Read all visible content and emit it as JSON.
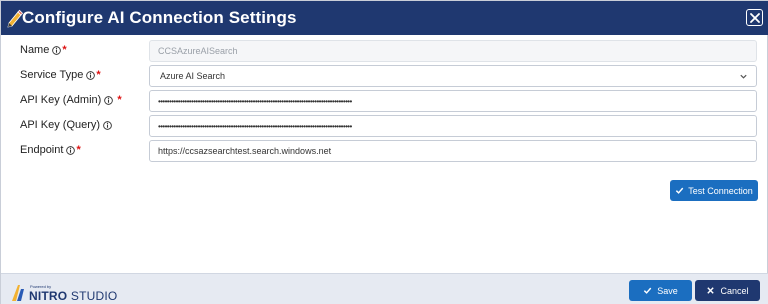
{
  "dialog": {
    "title": "Configure AI Connection Settings",
    "title_icon": "pencil-icon",
    "close_icon": "close-icon"
  },
  "form": {
    "name": {
      "label": "Name",
      "value": "CCSAzureAISearch",
      "required": true,
      "disabled": true
    },
    "service_type": {
      "label": "Service Type",
      "value": "Azure AI Search",
      "required": true
    },
    "api_key_admin": {
      "label": "API Key (Admin)",
      "value": "••••••••••••••••••••••••••••••••••••••••••••••••••••••••••••••••••••••••••••••••••••••••",
      "required": true
    },
    "api_key_query": {
      "label": "API Key (Query)",
      "value": "••••••••••••••••••••••••••••••••••••••••••••••••••••••••••••••••••••••••••••••••••••••••",
      "required": false
    },
    "endpoint": {
      "label": "Endpoint",
      "value": "https://ccsazsearchtest.search.windows.net",
      "required": true
    }
  },
  "buttons": {
    "test_connection": "Test Connection",
    "save": "Save",
    "cancel": "Cancel"
  },
  "footer": {
    "powered_by": "Powered by",
    "brand_main": "NITRO",
    "brand_sub": "STUDIO"
  },
  "colors": {
    "header_bg": "#1f3870",
    "primary_button": "#1b6ec0",
    "cancel_button": "#1f3870",
    "required": "#dd1111"
  }
}
